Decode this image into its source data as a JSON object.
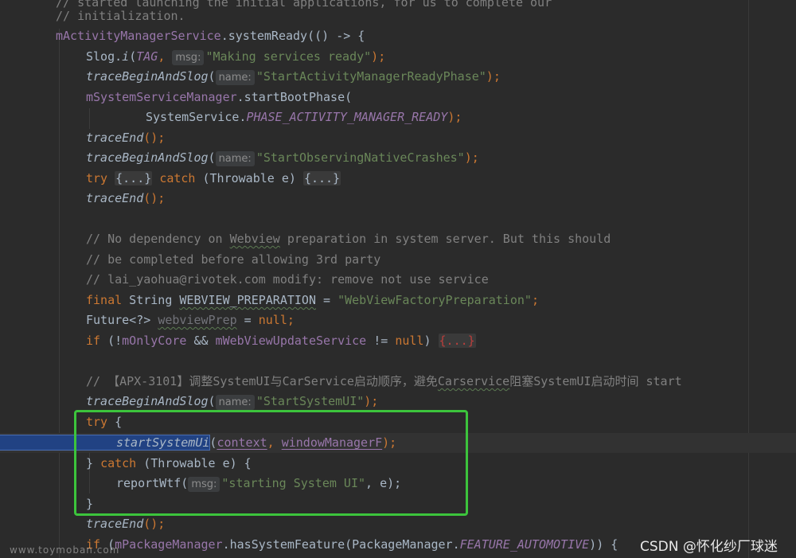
{
  "code": {
    "l0": "// started launching the initial applications, for us to complete our",
    "l1": "// initialization.",
    "l2a": "mActivityManagerService",
    "l2b": ".systemReady(() -> {",
    "l3a": "Slog.",
    "l3b": "i",
    "l3c": "(",
    "l3d": "TAG",
    "l3e": ", ",
    "l3hint": "msg:",
    "l3f": "\"Making services ready\"",
    "l3g": ");",
    "l4a": "traceBeginAndSlog",
    "l4b": "(",
    "l4hint": "name:",
    "l4c": "\"StartActivityManagerReadyPhase\"",
    "l4d": ");",
    "l5a": "mSystemServiceManager",
    "l5b": ".startBootPhase(",
    "l6a": "SystemService.",
    "l6b": "PHASE_ACTIVITY_MANAGER_READY",
    "l6c": ");",
    "l7a": "traceEnd",
    "l7b": "();",
    "l8a": "traceBeginAndSlog",
    "l8b": "(",
    "l8hint": "name:",
    "l8c": "\"StartObservingNativeCrashes\"",
    "l8d": ");",
    "l9a": "try",
    "l9b": "{...}",
    "l9c": "catch",
    "l9d": " (Throwable e) ",
    "l9e": "{...}",
    "l10a": "traceEnd",
    "l10b": "();",
    "l12a": "// No dependency on ",
    "l12b": "Webview",
    "l12c": " preparation in system server. But this should",
    "l13": "// be completed before allowing 3rd party",
    "l14": "// lai_yaohua@rivotek.com modify: remove not use service",
    "l15a": "final",
    "l15b": " String ",
    "l15c": "WEBVIEW_PREPARATION",
    "l15d": " = ",
    "l15e": "\"WebViewFactoryPreparation\"",
    "l15f": ";",
    "l16a": "Future<?> ",
    "l16b": "webviewPrep",
    "l16c": " = ",
    "l16d": "null",
    "l16e": ";",
    "l17a": "if",
    "l17b": " (!",
    "l17c": "mOnlyCore",
    "l17d": " && ",
    "l17e": "mWebViewUpdateService",
    "l17f": " != ",
    "l17g": "null",
    "l17h": ") ",
    "l17i": "{...}",
    "l19a": "// 【APX-3101】调整SystemUI与CarService启动顺序，避免",
    "l19b": "Carservice",
    "l19c": "阻塞SystemUI启动时间 start",
    "l20a": "traceBeginAndSlog",
    "l20b": "(",
    "l20hint": "name:",
    "l20c": "\"StartSystemUI\"",
    "l20d": ");",
    "l21a": "try",
    "l21b": " {",
    "l22a": "startSystemUi",
    "l22b": "(",
    "l22c": "context",
    "l22d": ", ",
    "l22e": "windowManagerF",
    "l22f": ");",
    "l23a": "} ",
    "l23b": "catch",
    "l23c": " (Throwable e) {",
    "l24a": "reportWtf(",
    "l24hint": "msg:",
    "l24b": "\"starting System UI\"",
    "l24c": ", e);",
    "l25": "}",
    "l26a": "traceEnd",
    "l26b": "();",
    "l27a": "if",
    "l27b": " (",
    "l27c": "mPackageManager",
    "l27d": ".hasSystemFeature(PackageManager.",
    "l27e": "FEATURE_AUTOMOTIVE",
    "l27f": ")) {"
  },
  "watermarks": {
    "left": "www.toymoban.com",
    "right": "CSDN @怀化纱厂球迷"
  },
  "colors": {
    "background": "#2b2b2b",
    "keyword": "#cc7832",
    "string": "#6a8759",
    "comment": "#808080",
    "field": "#9876aa",
    "annotation_box": "#3cc43c"
  }
}
